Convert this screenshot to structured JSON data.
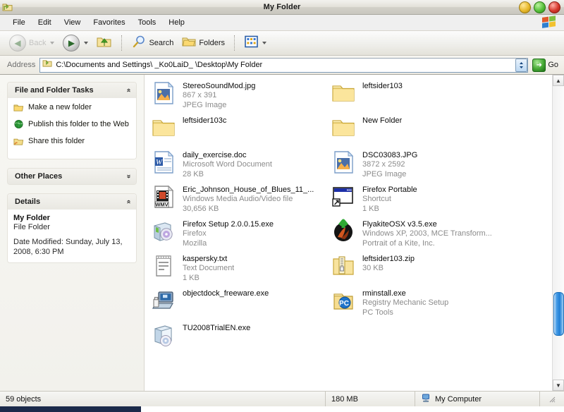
{
  "window": {
    "title": "My Folder",
    "icon": "folder-shortcut-icon",
    "buttons": {
      "minimize": "minimize",
      "maximize": "maximize",
      "close": "close"
    }
  },
  "menu": {
    "items": [
      "File",
      "Edit",
      "View",
      "Favorites",
      "Tools",
      "Help"
    ],
    "logo": "windows-flag-logo"
  },
  "toolbar": {
    "back_label": "Back",
    "forward_label": "",
    "up_label": "",
    "search_label": "Search",
    "folders_label": "Folders",
    "views_label": ""
  },
  "address": {
    "label": "Address",
    "value": "C:\\Documents and Settings\\ _Ko0LaiD_ \\Desktop\\My Folder",
    "go_label": "Go"
  },
  "sidebar": {
    "panels": [
      {
        "title": "File and Folder Tasks",
        "collapsed": false,
        "chevron": "«",
        "tasks": [
          {
            "label": "Make a new folder",
            "icon": "new-folder-icon"
          },
          {
            "label": "Publish this folder to the Web",
            "icon": "globe-icon"
          },
          {
            "label": "Share this folder",
            "icon": "shared-folder-icon"
          }
        ]
      },
      {
        "title": "Other Places",
        "collapsed": true,
        "chevron": "»",
        "tasks": []
      },
      {
        "title": "Details",
        "collapsed": false,
        "chevron": "«",
        "details": {
          "name": "My Folder",
          "type": "File Folder",
          "date_modified": "Date Modified: Sunday, July 13, 2008, 6:30 PM"
        }
      }
    ]
  },
  "files": [
    {
      "name": "StereoSoundMod.jpg",
      "line2": "867 x 391",
      "line3": "JPEG Image",
      "icon": "jpeg-image-icon"
    },
    {
      "name": "leftsider103",
      "line2": "",
      "line3": "",
      "icon": "folder-icon"
    },
    {
      "name": "leftsider103c",
      "line2": "",
      "line3": "",
      "icon": "folder-icon"
    },
    {
      "name": "New Folder",
      "line2": "",
      "line3": "",
      "icon": "folder-icon"
    },
    {
      "name": "daily_exercise.doc",
      "line2": "Microsoft Word Document",
      "line3": "28 KB",
      "icon": "word-document-icon"
    },
    {
      "name": "DSC03083.JPG",
      "line2": "3872 x 2592",
      "line3": "JPEG Image",
      "icon": "jpeg-image-icon"
    },
    {
      "name": "Eric_Johnson_House_of_Blues_11_...",
      "line2": "Windows Media Audio/Video file",
      "line3": "30,656 KB",
      "icon": "wmv-video-icon"
    },
    {
      "name": "Firefox Portable",
      "line2": "Shortcut",
      "line3": "1 KB",
      "icon": "shortcut-window-icon"
    },
    {
      "name": "Firefox Setup 2.0.0.15.exe",
      "line2": "Firefox",
      "line3": "Mozilla",
      "icon": "firefox-installer-icon"
    },
    {
      "name": "FlyakiteOSX v3.5.exe",
      "line2": "Windows XP, 2003, MCE Transform...",
      "line3": "Portrait of a Kite, Inc.",
      "icon": "flyakite-installer-icon"
    },
    {
      "name": "kaspersky.txt",
      "line2": "Text Document",
      "line3": "1 KB",
      "icon": "text-document-icon"
    },
    {
      "name": "leftsider103.zip",
      "line2": "30 KB",
      "line3": "",
      "icon": "zip-archive-icon"
    },
    {
      "name": "objectdock_freeware.exe",
      "line2": "",
      "line3": "",
      "icon": "objectdock-setup-icon"
    },
    {
      "name": "rminstall.exe",
      "line2": "Registry Mechanic Setup",
      "line3": "PC Tools",
      "icon": "registry-mechanic-icon"
    },
    {
      "name": "TU2008TrialEN.exe",
      "line2": "",
      "line3": "",
      "icon": "software-box-icon"
    }
  ],
  "scrollbar": {
    "up_arrow": "▲",
    "down_arrow": "▼",
    "thumb_position_percent": 82
  },
  "statusbar": {
    "objects": "59 objects",
    "size": "180 MB",
    "location": "My Computer",
    "location_icon": "my-computer-icon"
  },
  "colors": {
    "accent_blue": "#1f7fd6",
    "folder_yellow": "#f5d36a",
    "chrome_gray": "#ece9d8"
  }
}
